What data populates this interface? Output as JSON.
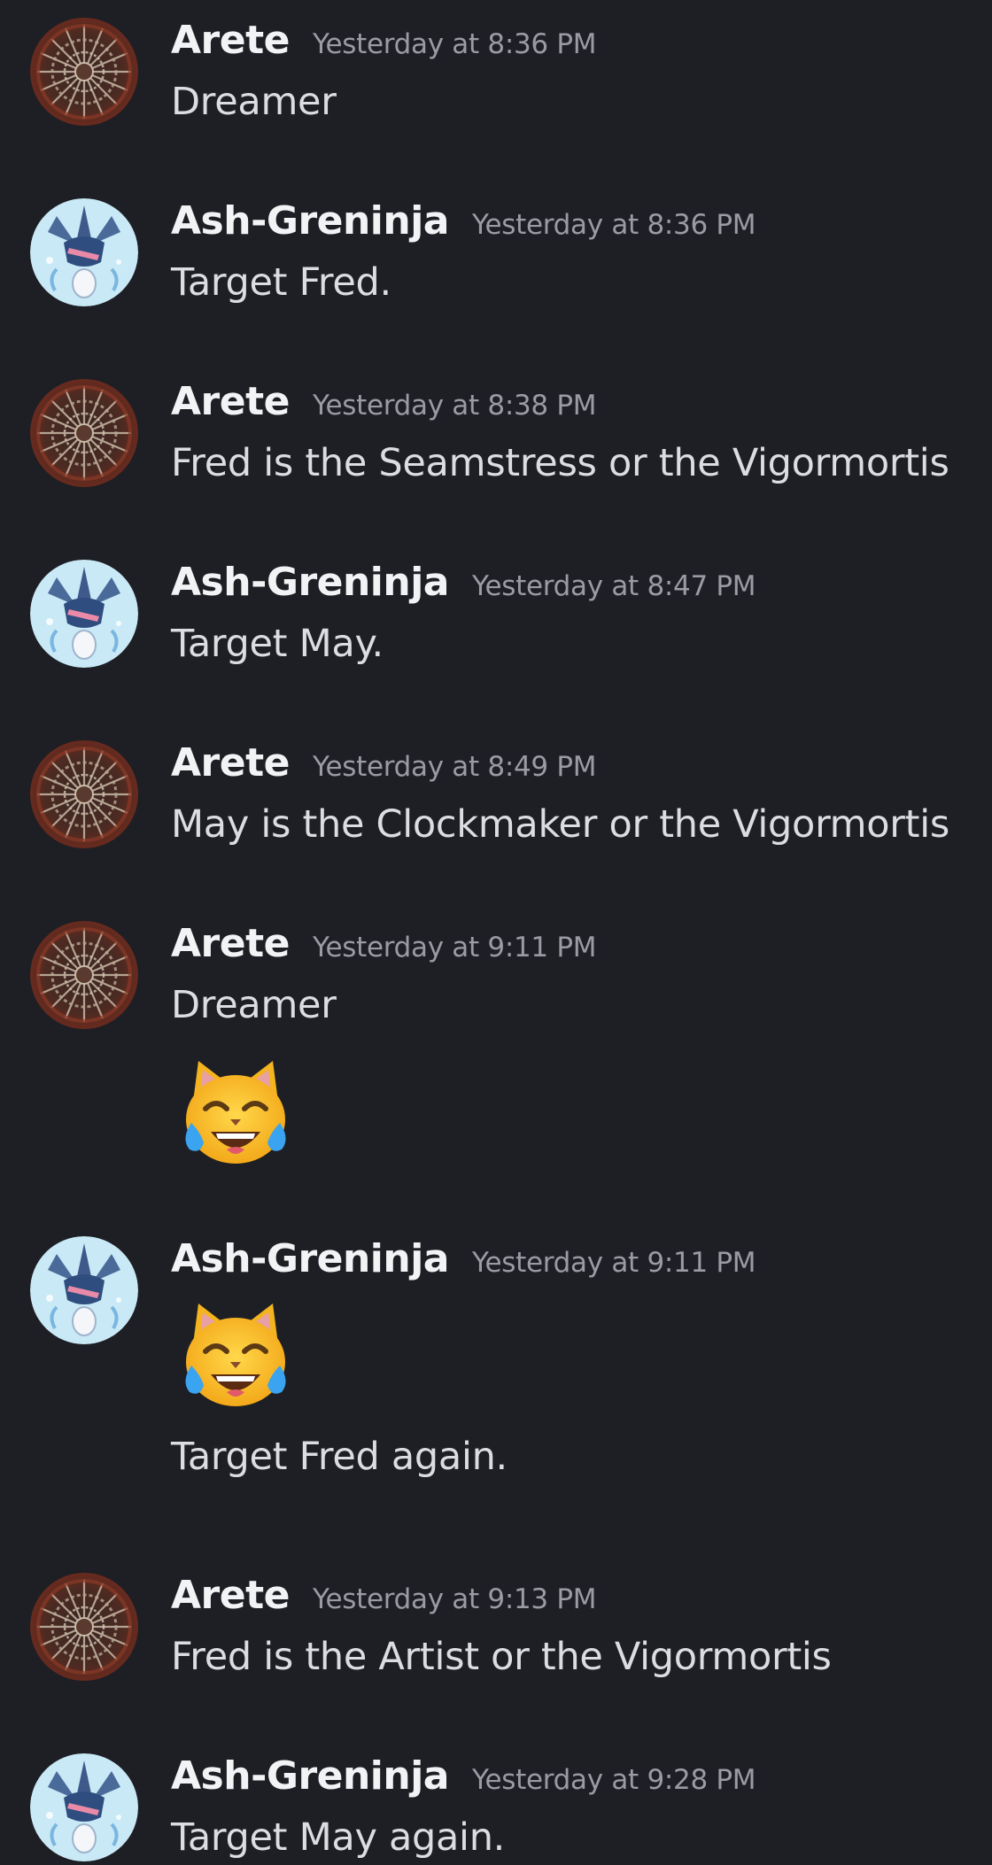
{
  "messages": [
    {
      "author": "Arete",
      "timestamp": "Yesterday at 8:36 PM",
      "text": "Dreamer",
      "avatar_icon": "mandala-avatar-icon"
    },
    {
      "author": "Ash-Greninja",
      "timestamp": "Yesterday at 8:36 PM",
      "text": "Target Fred.",
      "avatar_icon": "greninja-avatar-icon"
    },
    {
      "author": "Arete",
      "timestamp": "Yesterday at 8:38 PM",
      "text": "Fred is the Seamstress or the Vigormortis",
      "avatar_icon": "mandala-avatar-icon"
    },
    {
      "author": "Ash-Greninja",
      "timestamp": "Yesterday at 8:47 PM",
      "text": "Target May.",
      "avatar_icon": "greninja-avatar-icon"
    },
    {
      "author": "Arete",
      "timestamp": "Yesterday at 8:49 PM",
      "text": "May is the Clockmaker or the Vigormortis",
      "avatar_icon": "mandala-avatar-icon"
    },
    {
      "author": "Arete",
      "timestamp": "Yesterday at 9:11 PM",
      "text": "Dreamer",
      "emoji": "joy-cat-emoji",
      "avatar_icon": "mandala-avatar-icon"
    },
    {
      "author": "Ash-Greninja",
      "timestamp": "Yesterday at 9:11 PM",
      "emoji": "joy-cat-emoji",
      "text": "Target Fred again.",
      "avatar_icon": "greninja-avatar-icon"
    },
    {
      "author": "Arete",
      "timestamp": "Yesterday at 9:13 PM",
      "text": "Fred is the Artist or the Vigormortis",
      "avatar_icon": "mandala-avatar-icon"
    },
    {
      "author": "Ash-Greninja",
      "timestamp": "Yesterday at 9:28 PM",
      "text": "Target May again.",
      "avatar_icon": "greninja-avatar-icon"
    }
  ],
  "colors": {
    "background": "#1e1f24",
    "author": "#f2f3f5",
    "timestamp": "#9a9ba3",
    "message_text": "#dcdde2"
  }
}
